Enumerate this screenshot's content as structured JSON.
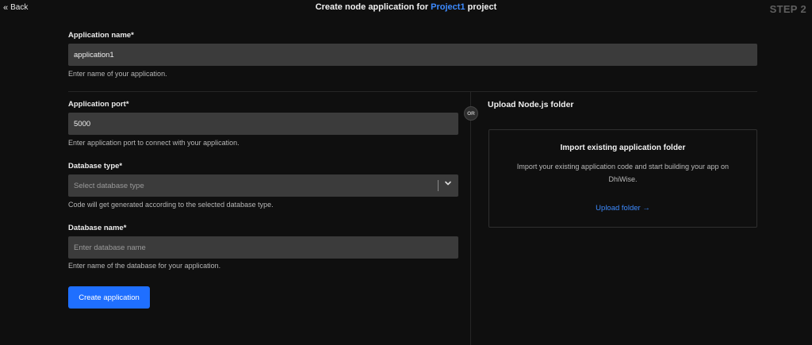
{
  "header": {
    "back_label": "Back",
    "back_icon": "double-chevron-left-icon",
    "title_prefix": "Create node application for ",
    "project_name": "Project1",
    "title_suffix": " project",
    "step_label": "STEP 2",
    "project_color": "#3d8bff"
  },
  "form": {
    "app_name": {
      "label": "Application name*",
      "value": "application1",
      "helper": "Enter name of your application."
    },
    "app_port": {
      "label": "Application port*",
      "value": "5000",
      "helper": "Enter application port to connect with your application."
    },
    "db_type": {
      "label": "Database type*",
      "placeholder": "Select database type",
      "helper": "Code will get generated according to the selected database type.",
      "icon": "chevron-down-icon"
    },
    "db_name": {
      "label": "Database name*",
      "placeholder": "Enter database name",
      "helper": "Enter name of the database for your application."
    },
    "submit_label": "Create application",
    "submit_color": "#1f6fff"
  },
  "or_label": "OR",
  "upload": {
    "heading": "Upload Node.js folder",
    "box_title": "Import existing application folder",
    "box_desc": "Import your existing application code and start building your app on DhiWise.",
    "link_label": "Upload folder →",
    "link_color": "#3d8bff"
  }
}
